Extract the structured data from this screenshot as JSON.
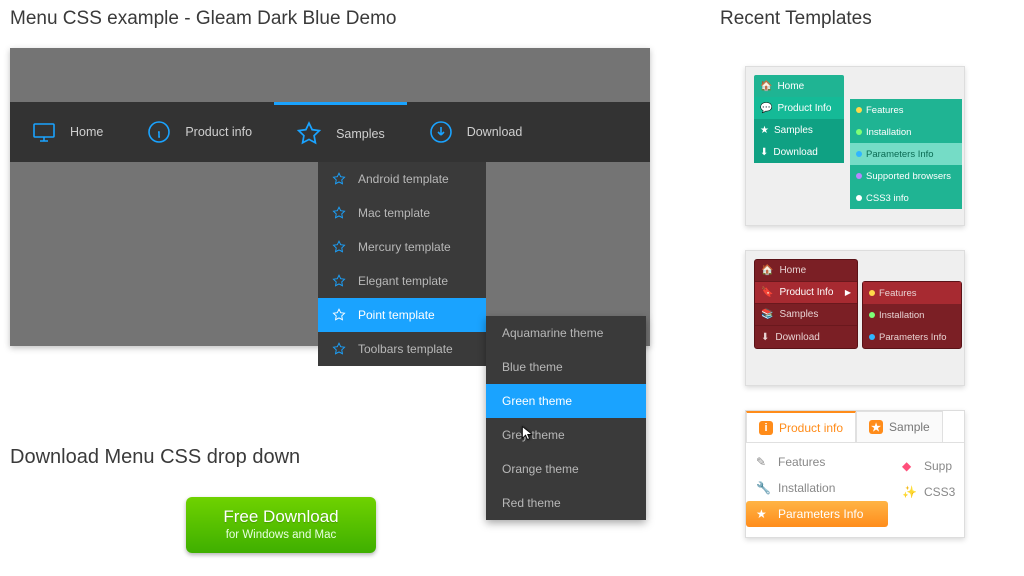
{
  "heading_left": "Menu CSS example - Gleam Dark Blue Demo",
  "heading_right": "Recent Templates",
  "download_heading": "Download Menu CSS drop down",
  "free_btn": {
    "line1": "Free Download",
    "line2": "for Windows and Mac"
  },
  "bar": {
    "home": "Home",
    "product_info": "Product info",
    "samples": "Samples",
    "download": "Download"
  },
  "sub1": [
    "Android template",
    "Mac template",
    "Mercury template",
    "Elegant template",
    "Point template",
    "Toolbars template"
  ],
  "sub1_selected_index": 4,
  "sub2": [
    "Aquamarine theme",
    "Blue theme",
    "Green theme",
    "Grey theme",
    "Orange theme",
    "Red theme"
  ],
  "sub2_selected_index": 2,
  "thumb1": {
    "main": [
      "Home",
      "Product Info",
      "Samples",
      "Download"
    ],
    "sub": [
      "Features",
      "Installation",
      "Parameters Info",
      "Supported browsers",
      "CSS3 info"
    ]
  },
  "thumb2": {
    "main": [
      "Home",
      "Product Info",
      "Samples",
      "Download"
    ],
    "sub": [
      "Features",
      "Installation",
      "Parameters Info"
    ]
  },
  "thumb3": {
    "tabs": [
      "Product info",
      "Sample"
    ],
    "left": [
      "Features",
      "Installation",
      "Parameters Info"
    ],
    "right": [
      "Supp",
      "CSS3"
    ]
  }
}
